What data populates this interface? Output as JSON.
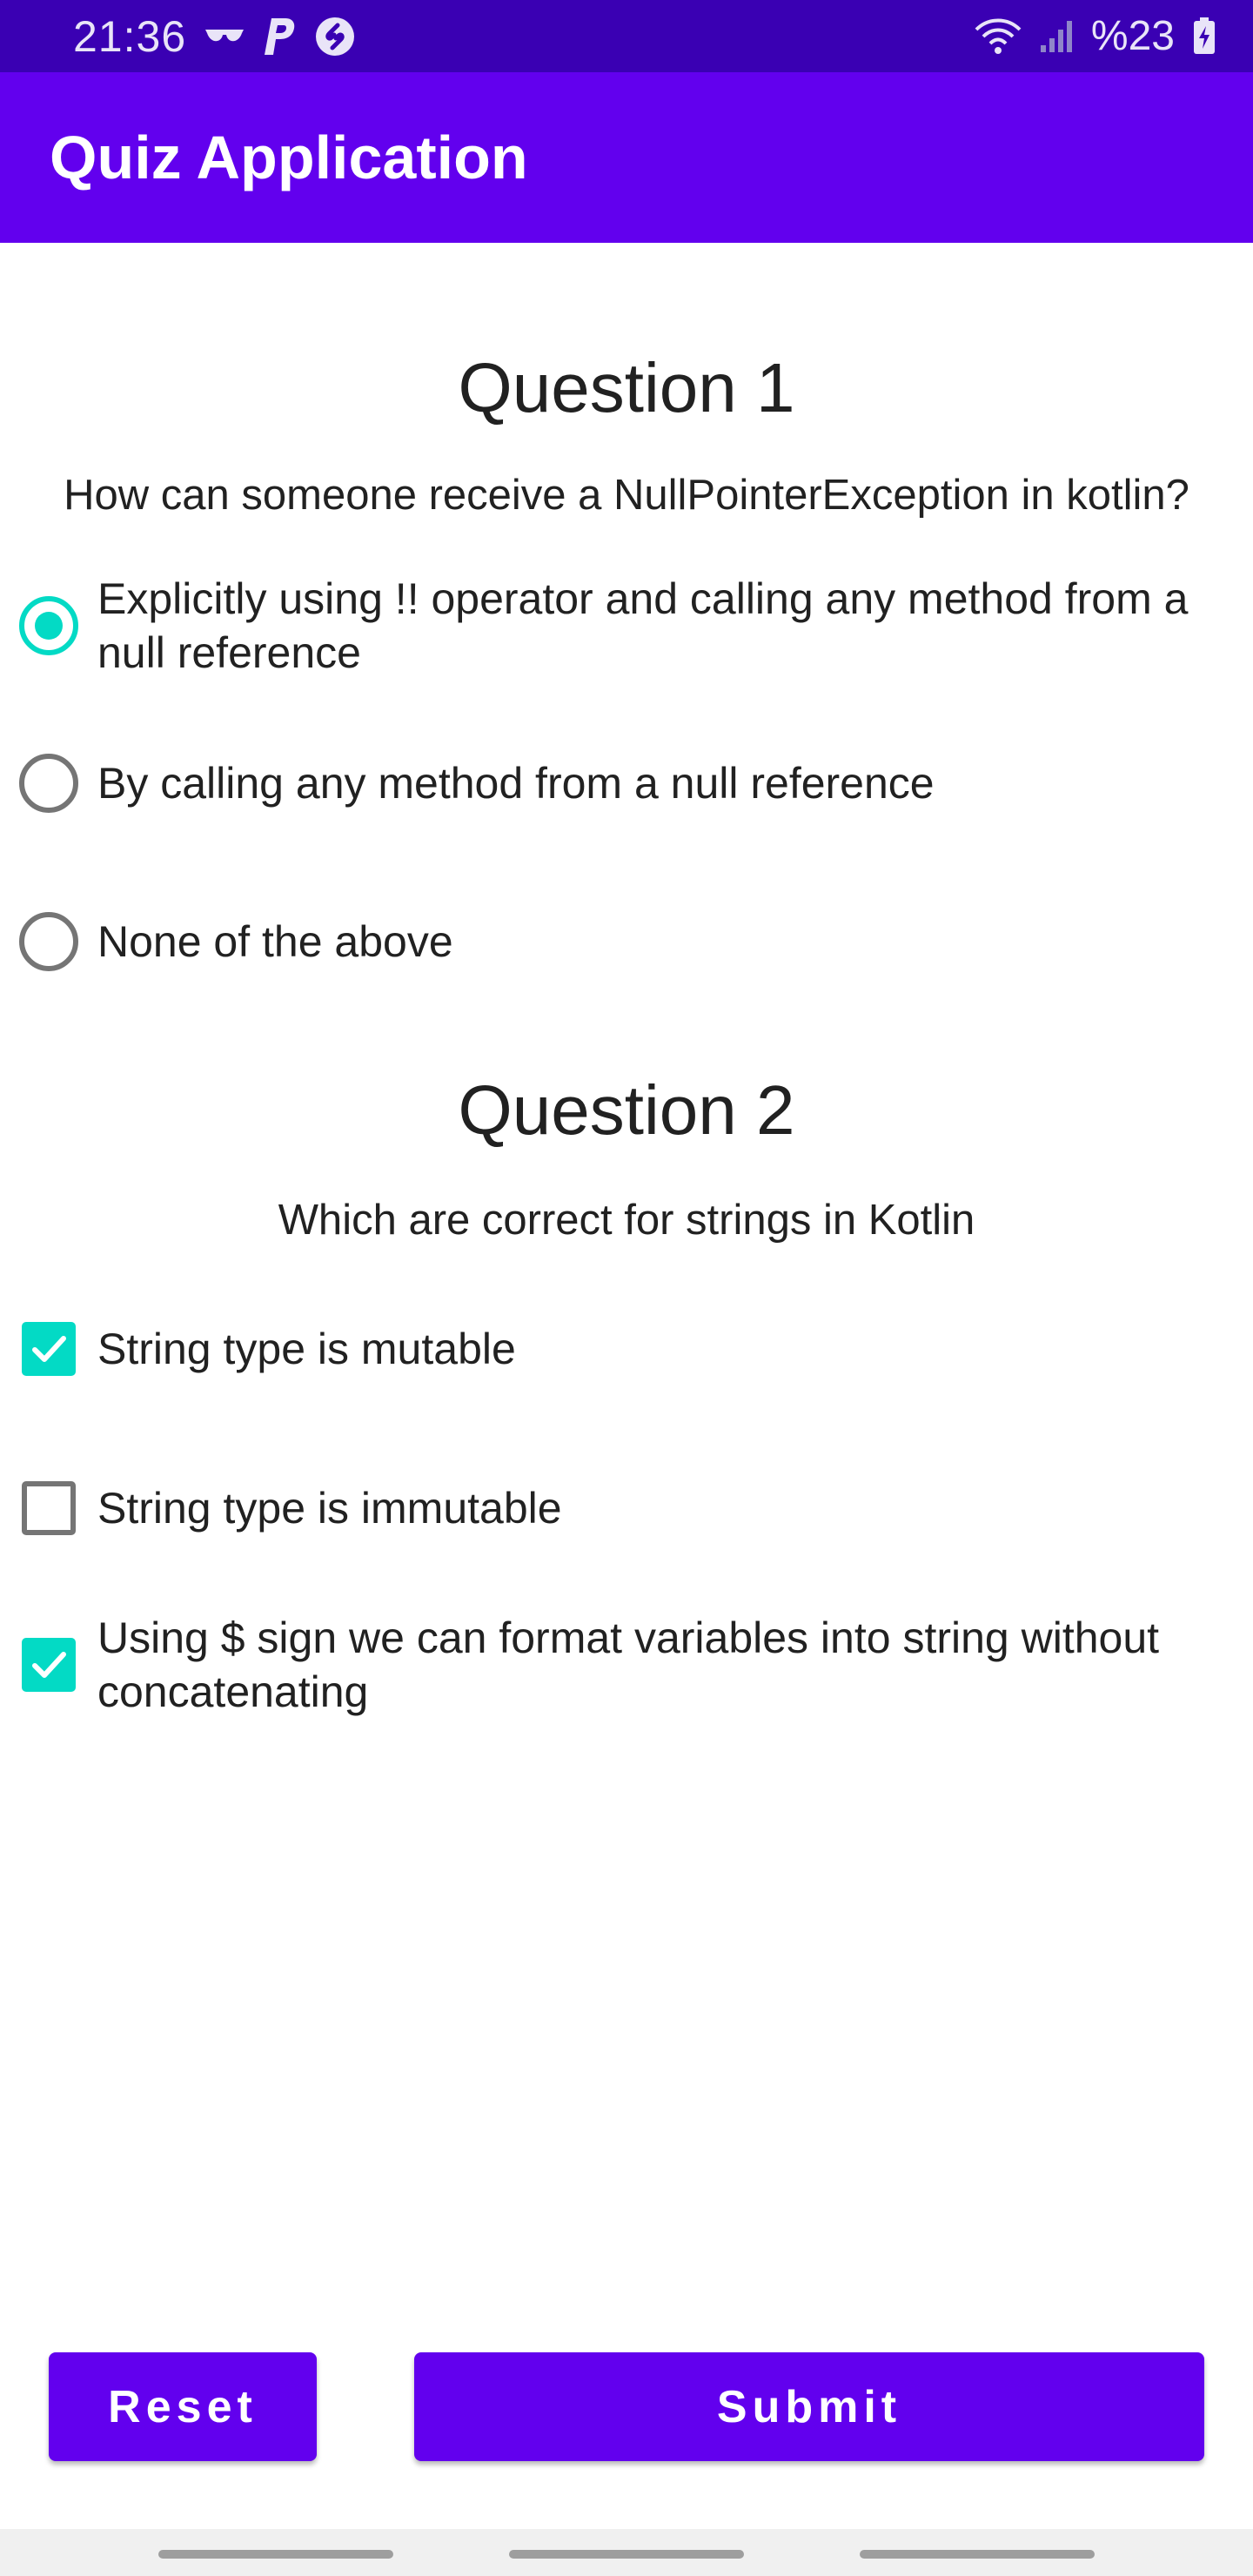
{
  "status_bar": {
    "time": "21:36",
    "left_icons": [
      "glasses-icon",
      "paypal-icon",
      "shazam-icon"
    ],
    "right_icons": [
      "wifi-icon",
      "signal-icon",
      "battery-charging-icon"
    ],
    "battery_percent": "%23"
  },
  "app_bar": {
    "title": "Quiz Application",
    "color": "#6200ee"
  },
  "question1": {
    "title": "Question 1",
    "text": "How can someone receive a NullPointerException in kotlin?",
    "options": [
      {
        "label": "Explicitly using !! operator and calling any method from a null reference",
        "checked": true
      },
      {
        "label": "By calling any method from a null reference",
        "checked": false
      },
      {
        "label": "None of the above",
        "checked": false
      }
    ]
  },
  "question2": {
    "title": "Question 2",
    "text": "Which are correct for strings in Kotlin",
    "options": [
      {
        "label": "String type is mutable",
        "checked": true
      },
      {
        "label": "String type is immutable",
        "checked": false
      },
      {
        "label": "Using $ sign we can format variables into string without concatenating",
        "checked": true
      }
    ]
  },
  "buttons": {
    "reset_label": "Reset",
    "submit_label": "Submit"
  },
  "colors": {
    "accent": "#03dac5",
    "primary": "#6200ee",
    "status_bar": "#3a00b3"
  }
}
